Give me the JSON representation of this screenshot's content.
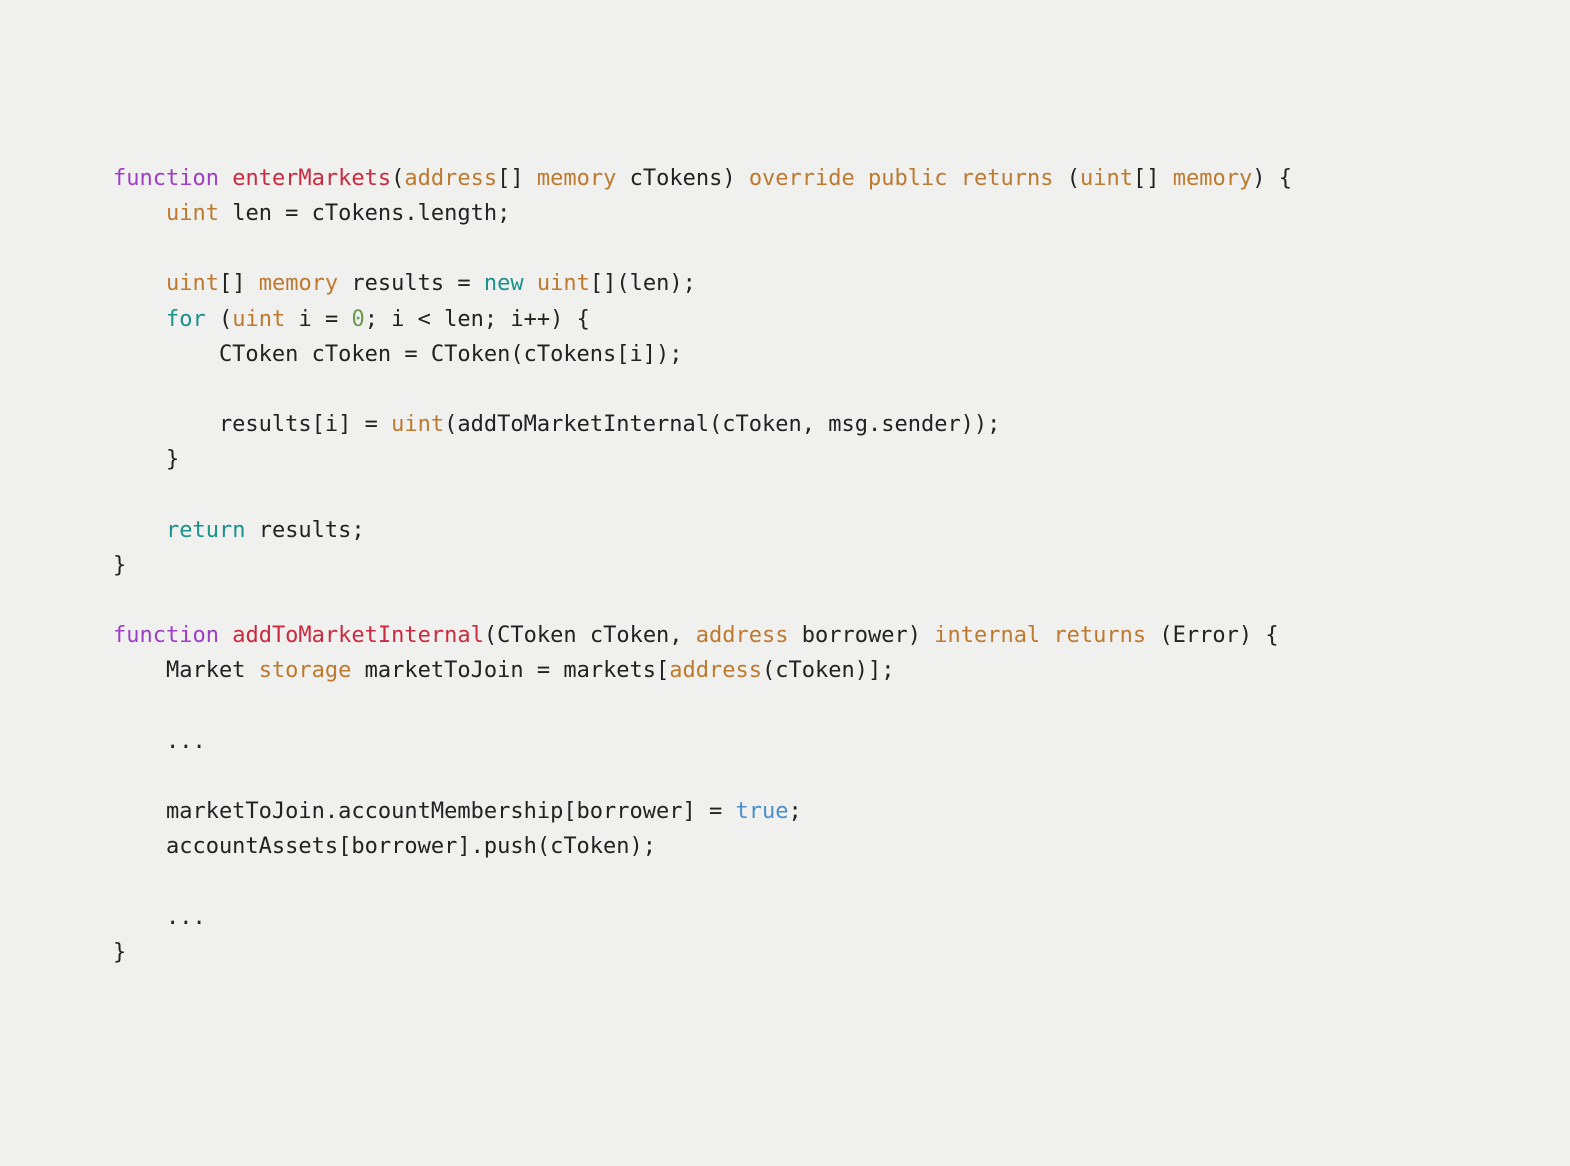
{
  "tokens": [
    {
      "t": "    ",
      "c": ""
    },
    {
      "t": "function",
      "c": "k-purple"
    },
    {
      "t": " ",
      "c": ""
    },
    {
      "t": "enterMarkets",
      "c": "k-red"
    },
    {
      "t": "(",
      "c": ""
    },
    {
      "t": "address",
      "c": "k-orange"
    },
    {
      "t": "[] ",
      "c": ""
    },
    {
      "t": "memory",
      "c": "k-orange"
    },
    {
      "t": " cTokens) ",
      "c": ""
    },
    {
      "t": "override",
      "c": "k-orange"
    },
    {
      "t": " ",
      "c": ""
    },
    {
      "t": "public",
      "c": "k-orange"
    },
    {
      "t": " ",
      "c": ""
    },
    {
      "t": "returns",
      "c": "k-orange"
    },
    {
      "t": " (",
      "c": ""
    },
    {
      "t": "uint",
      "c": "k-orange"
    },
    {
      "t": "[] ",
      "c": ""
    },
    {
      "t": "memory",
      "c": "k-orange"
    },
    {
      "t": ") {\n",
      "c": ""
    },
    {
      "t": "        ",
      "c": ""
    },
    {
      "t": "uint",
      "c": "k-orange"
    },
    {
      "t": " len = cTokens.length;\n",
      "c": ""
    },
    {
      "t": "\n",
      "c": ""
    },
    {
      "t": "        ",
      "c": ""
    },
    {
      "t": "uint",
      "c": "k-orange"
    },
    {
      "t": "[] ",
      "c": ""
    },
    {
      "t": "memory",
      "c": "k-orange"
    },
    {
      "t": " results = ",
      "c": ""
    },
    {
      "t": "new",
      "c": "k-teal"
    },
    {
      "t": " ",
      "c": ""
    },
    {
      "t": "uint",
      "c": "k-orange"
    },
    {
      "t": "[](len);\n",
      "c": ""
    },
    {
      "t": "        ",
      "c": ""
    },
    {
      "t": "for",
      "c": "k-teal"
    },
    {
      "t": " (",
      "c": ""
    },
    {
      "t": "uint",
      "c": "k-orange"
    },
    {
      "t": " i = ",
      "c": ""
    },
    {
      "t": "0",
      "c": "k-green"
    },
    {
      "t": "; i < len; i++) {\n",
      "c": ""
    },
    {
      "t": "            CToken cToken = CToken(cTokens[i]);\n",
      "c": ""
    },
    {
      "t": "\n",
      "c": ""
    },
    {
      "t": "            results[i] = ",
      "c": ""
    },
    {
      "t": "uint",
      "c": "k-orange"
    },
    {
      "t": "(addToMarketInternal(cToken, msg.sender));\n",
      "c": ""
    },
    {
      "t": "        }\n",
      "c": ""
    },
    {
      "t": "\n",
      "c": ""
    },
    {
      "t": "        ",
      "c": ""
    },
    {
      "t": "return",
      "c": "k-teal"
    },
    {
      "t": " results;\n",
      "c": ""
    },
    {
      "t": "    }\n",
      "c": ""
    },
    {
      "t": "\n",
      "c": ""
    },
    {
      "t": "    ",
      "c": ""
    },
    {
      "t": "function",
      "c": "k-purple"
    },
    {
      "t": " ",
      "c": ""
    },
    {
      "t": "addToMarketInternal",
      "c": "k-red"
    },
    {
      "t": "(CToken cToken, ",
      "c": ""
    },
    {
      "t": "address",
      "c": "k-orange"
    },
    {
      "t": " borrower) ",
      "c": ""
    },
    {
      "t": "internal",
      "c": "k-orange"
    },
    {
      "t": " ",
      "c": ""
    },
    {
      "t": "returns",
      "c": "k-orange"
    },
    {
      "t": " (Error) {\n",
      "c": ""
    },
    {
      "t": "        Market ",
      "c": ""
    },
    {
      "t": "storage",
      "c": "k-orange"
    },
    {
      "t": " marketToJoin = markets[",
      "c": ""
    },
    {
      "t": "address",
      "c": "k-orange"
    },
    {
      "t": "(cToken)];\n",
      "c": ""
    },
    {
      "t": "\n",
      "c": ""
    },
    {
      "t": "        ...\n",
      "c": ""
    },
    {
      "t": "\n",
      "c": ""
    },
    {
      "t": "        marketToJoin.accountMembership[borrower] = ",
      "c": ""
    },
    {
      "t": "true",
      "c": "k-blue"
    },
    {
      "t": ";\n",
      "c": ""
    },
    {
      "t": "        accountAssets[borrower].push(cToken);\n",
      "c": ""
    },
    {
      "t": "\n",
      "c": ""
    },
    {
      "t": "        ...\n",
      "c": ""
    },
    {
      "t": "    }",
      "c": ""
    }
  ]
}
